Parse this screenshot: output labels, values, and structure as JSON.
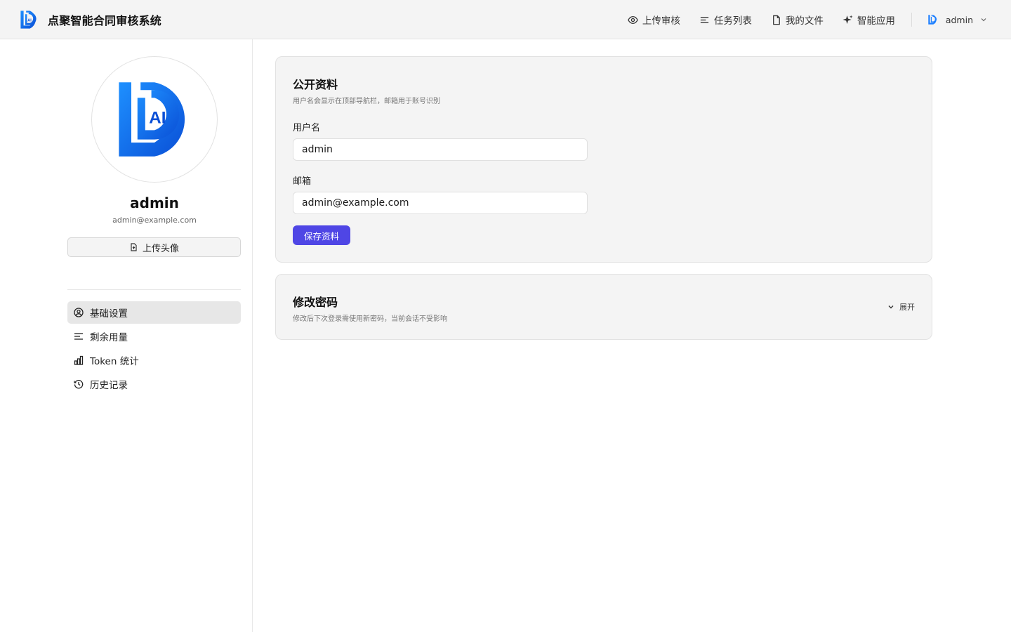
{
  "header": {
    "title": "点聚智能合同审核系统",
    "nav": [
      {
        "label": "上传审核",
        "icon": "eye-icon"
      },
      {
        "label": "任务列表",
        "icon": "list-icon"
      },
      {
        "label": "我的文件",
        "icon": "file-icon"
      },
      {
        "label": "智能应用",
        "icon": "sparkle-icon"
      }
    ],
    "user": "admin"
  },
  "sidebar": {
    "name": "admin",
    "email": "admin@example.com",
    "upload_label": "上传头像",
    "menu": [
      {
        "label": "基础设置",
        "icon": "user-circle-icon",
        "active": true
      },
      {
        "label": "剩余用量",
        "icon": "list-icon",
        "active": false
      },
      {
        "label": "Token 统计",
        "icon": "bar-chart-icon",
        "active": false
      },
      {
        "label": "历史记录",
        "icon": "history-icon",
        "active": false
      }
    ]
  },
  "profile_card": {
    "title": "公开资料",
    "subtitle": "用户名会显示在顶部导航栏，邮箱用于账号识别",
    "username_label": "用户名",
    "username_value": "admin",
    "email_label": "邮箱",
    "email_value": "admin@example.com",
    "save_label": "保存资料"
  },
  "password_card": {
    "title": "修改密码",
    "subtitle": "修改后下次登录需使用新密码，当前会话不受影响",
    "expand_label": "展开"
  },
  "colors": {
    "primary": "#4f46e5",
    "logo_blue": "#1677ff"
  }
}
